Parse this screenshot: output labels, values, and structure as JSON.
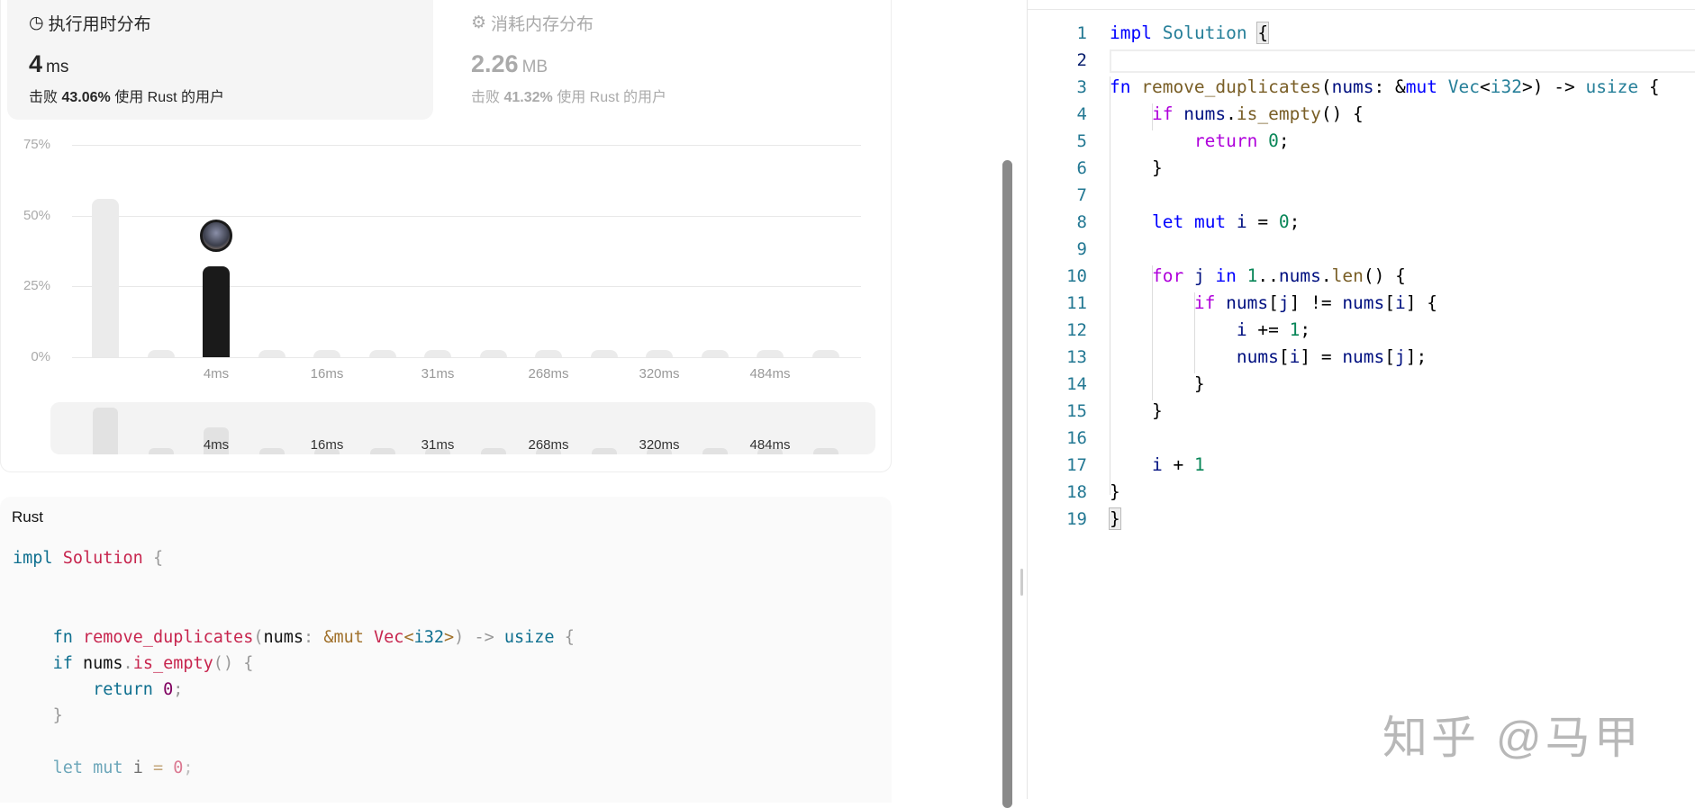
{
  "runtime": {
    "title": "执行用时分布",
    "value": "4",
    "unit": "ms",
    "beat_prefix": "击败",
    "beat_percent": "43.06%",
    "beat_suffix": "使用 Rust 的用户"
  },
  "memory": {
    "title": "消耗内存分布",
    "value": "2.26",
    "unit": "MB",
    "beat_prefix": "击败",
    "beat_percent": "41.32%",
    "beat_suffix": "使用 Rust 的用户"
  },
  "chart_data": {
    "type": "bar",
    "title": "执行用时分布",
    "ylabel": "",
    "xlabel": "",
    "ylim": [
      0,
      75
    ],
    "yticks": [
      "75%",
      "50%",
      "25%",
      "0%"
    ],
    "categories": [
      "",
      "",
      "4ms",
      "",
      "16ms",
      "",
      "31ms",
      "",
      "268ms",
      "",
      "320ms",
      "",
      "484ms",
      ""
    ],
    "values": [
      56,
      2,
      32,
      2,
      2,
      2,
      2,
      2,
      2,
      2,
      2,
      2,
      2,
      2
    ],
    "highlight_index": 2,
    "grid": true,
    "overview_values": [
      56,
      2,
      32,
      2,
      2,
      2,
      2,
      2,
      2,
      2,
      2,
      2,
      2,
      2
    ]
  },
  "colors": {
    "highlight": "#1a1a1a",
    "bar": "#ebebeb"
  },
  "solution": {
    "language": "Rust",
    "lines": [
      "impl Solution {",
      "",
      "",
      "    fn remove_duplicates(nums: &mut Vec<i32>) -> usize {",
      "    if nums.is_empty() {",
      "        return 0;",
      "    }",
      "",
      "    let mut i = 0;"
    ]
  },
  "editor": {
    "line_numbers": [
      "1",
      "2",
      "3",
      "4",
      "5",
      "6",
      "7",
      "8",
      "9",
      "10",
      "11",
      "12",
      "13",
      "14",
      "15",
      "16",
      "17",
      "18",
      "19"
    ]
  },
  "watermark": "知乎 @马甲"
}
